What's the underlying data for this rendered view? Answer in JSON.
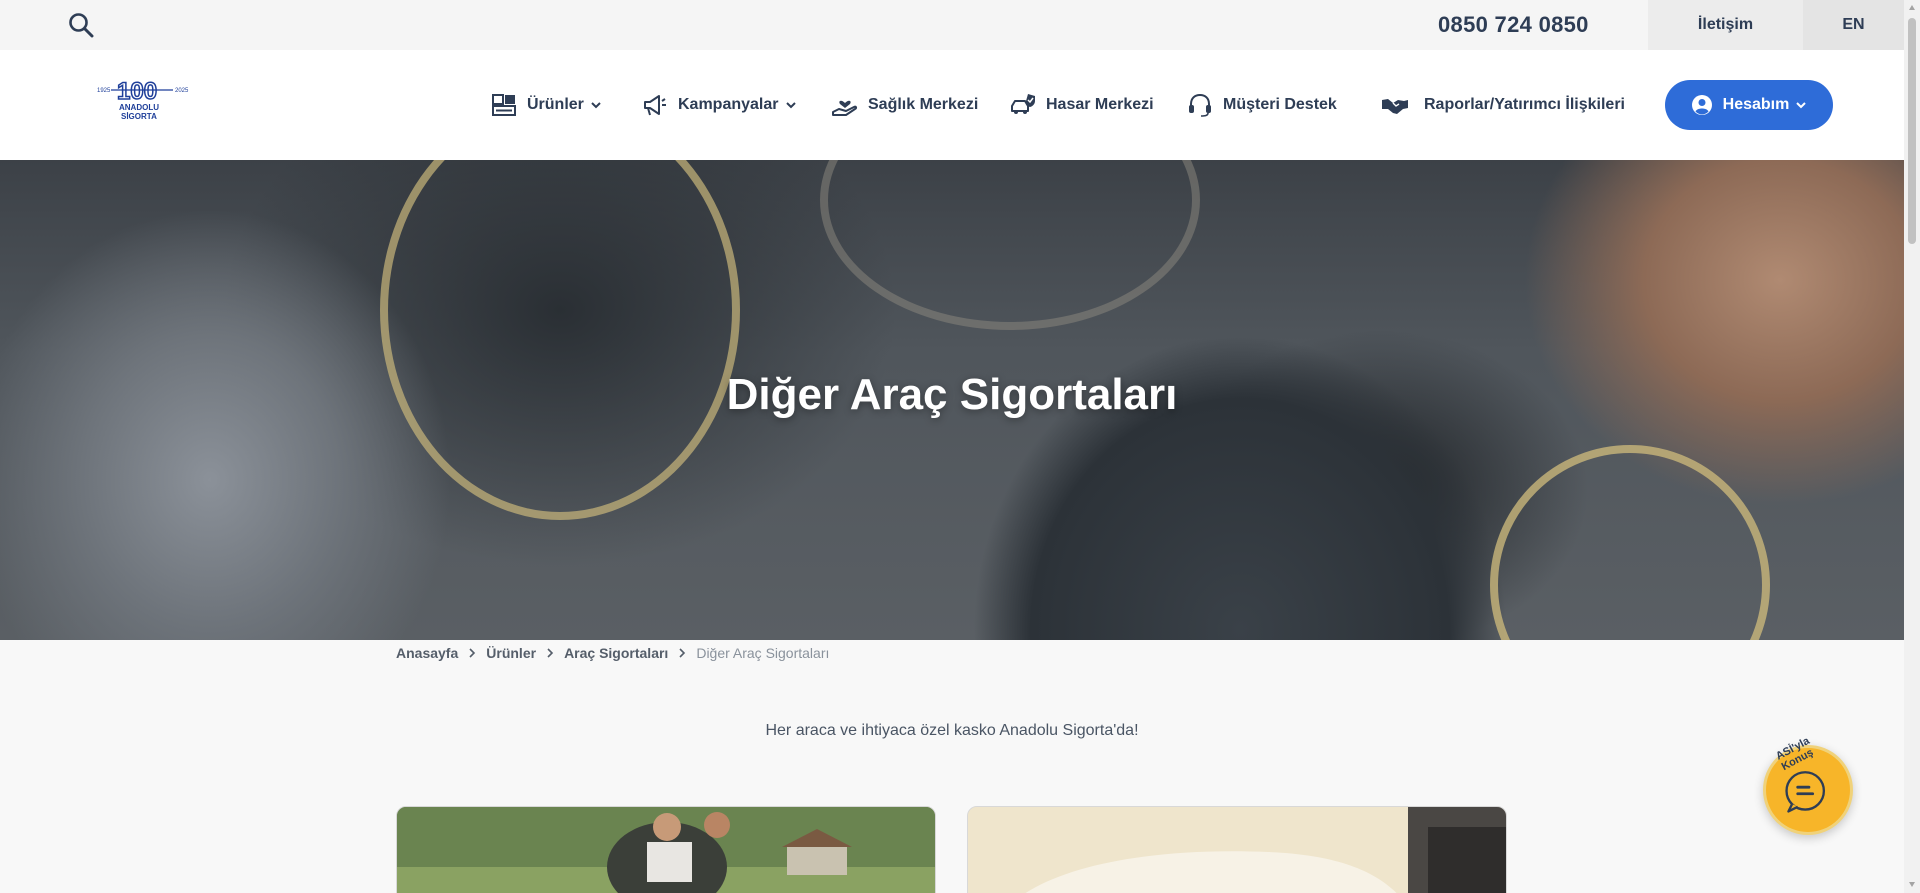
{
  "topbar": {
    "phone": "0850 724 0850",
    "contact_label": "İletişim",
    "lang_label": "EN"
  },
  "logo": {
    "year_start": "1925",
    "year_end": "2025",
    "badge": "100",
    "line1": "ANADOLU",
    "line2": "SİGORTA"
  },
  "nav": {
    "items": [
      {
        "label": "Ürünler",
        "icon": "products-icon"
      },
      {
        "label": "Kampanyalar",
        "icon": "megaphone-icon"
      },
      {
        "label": "Sağlık Merkezi",
        "icon": "health-hand-icon"
      },
      {
        "label": "Hasar Merkezi",
        "icon": "car-damage-icon"
      },
      {
        "label": "Müşteri Destek",
        "icon": "headset-icon"
      },
      {
        "label": "Raporlar/Yatırımcı İlişkileri",
        "icon": "handshake-icon"
      }
    ],
    "account_label": "Hesabım"
  },
  "hero": {
    "title": "Diğer Araç Sigortaları"
  },
  "breadcrumb": {
    "items": [
      "Anasayfa",
      "Ürünler",
      "Araç Sigortaları"
    ],
    "current": "Diğer Araç Sigortaları"
  },
  "subtitle": "Her araca ve ihtiyaca özel kasko Anadolu Sigorta'da!",
  "chat": {
    "label": "ASİ'yla Konuş"
  },
  "colors": {
    "primary_text": "#2e3d55",
    "accent_blue": "#2e6cd8",
    "chat_yellow": "#f7b529"
  }
}
